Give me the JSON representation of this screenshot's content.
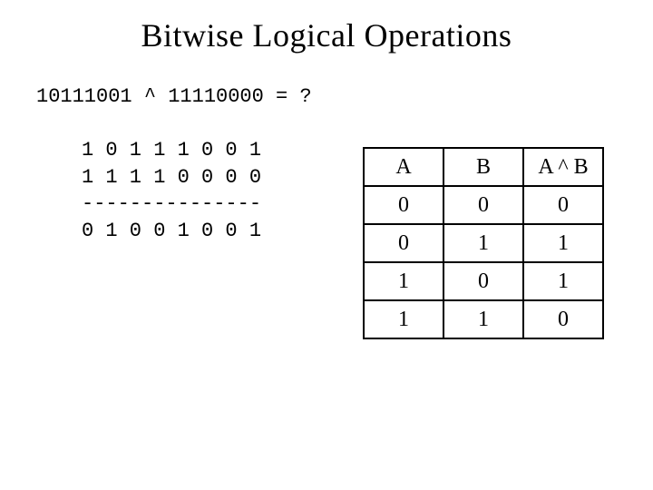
{
  "title": "Bitwise Logical Operations",
  "expression": "10111001 ^ 11110000 = ?",
  "work": {
    "row1": "1 0 1 1 1 0 0 1",
    "row2": "1 1 1 1 0 0 0 0",
    "sep": "---------------",
    "row3": "0 1 0 0 1 0 0 1"
  },
  "truth": {
    "h1": "A",
    "h2": "B",
    "h3": "A ^ B",
    "r": [
      [
        "0",
        "0",
        "0"
      ],
      [
        "0",
        "1",
        "1"
      ],
      [
        "1",
        "0",
        "1"
      ],
      [
        "1",
        "1",
        "0"
      ]
    ]
  }
}
